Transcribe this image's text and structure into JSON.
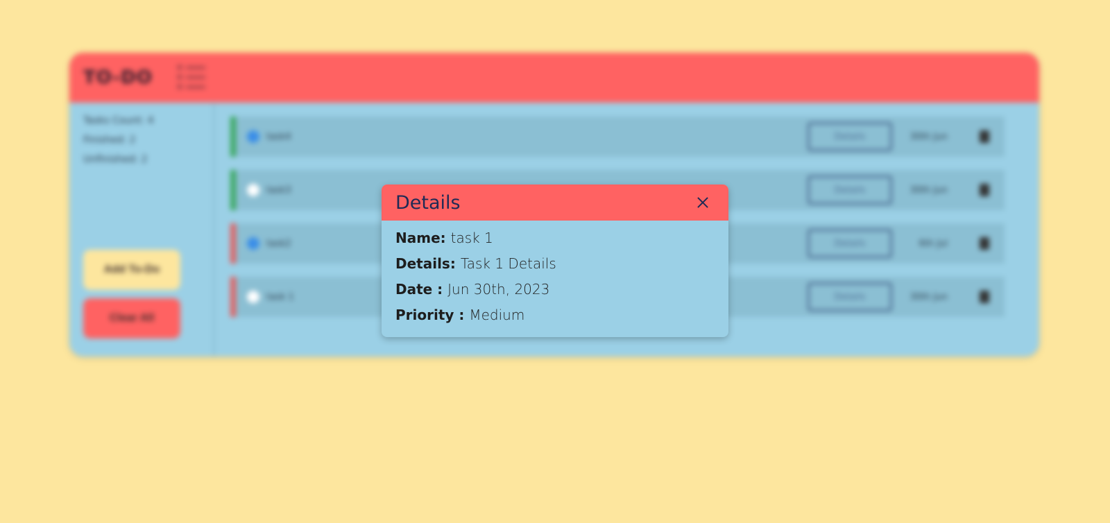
{
  "app": {
    "title": "TO-DO",
    "stats": {
      "count": "Tasks Count: 4",
      "finished": "Finished: 2",
      "unfinished": "Unfinished: 2"
    },
    "buttons": {
      "add": "Add To-Do",
      "clear": "Clear All"
    },
    "tasks": [
      {
        "name": "task4",
        "details_label": "Details",
        "date": "30th Jun",
        "checked": true,
        "priority_color": "#3aa860"
      },
      {
        "name": "task3",
        "details_label": "Details",
        "date": "30th Jun",
        "checked": false,
        "priority_color": "#3aa860"
      },
      {
        "name": "task2",
        "details_label": "Details",
        "date": "6th Jul",
        "checked": true,
        "priority_color": "#e26060"
      },
      {
        "name": "task 1",
        "details_label": "Details",
        "date": "30th Jun",
        "checked": false,
        "priority_color": "#e26060"
      }
    ]
  },
  "modal": {
    "title": "Details",
    "name_label": "Name:",
    "name_value": "task 1",
    "details_label": "Details:",
    "details_value": "Task 1 Details",
    "date_label": "Date :",
    "date_value": "Jun 30th, 2023",
    "priority_label": "Priority :",
    "priority_value": "Medium"
  },
  "colors": {
    "background": "#fde69e",
    "header": "#ff6262",
    "panel": "#9bd0e6",
    "title_text": "#1f2a55"
  }
}
